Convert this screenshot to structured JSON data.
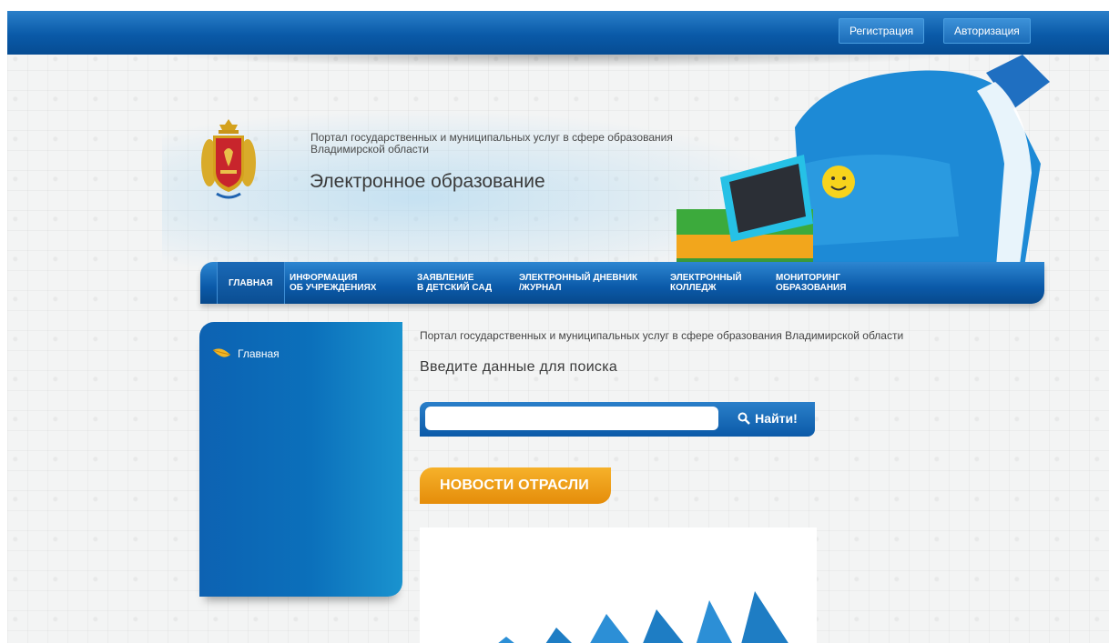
{
  "topbar": {
    "register_label": "Регистрация",
    "login_label": "Авторизация"
  },
  "header": {
    "subtitle": "Портал государственных и муниципальных услуг в сфере образования Владимирской области",
    "title": "Электронное образование"
  },
  "nav": {
    "items": [
      {
        "line1": "ГЛАВНАЯ",
        "line2": ""
      },
      {
        "line1": "ИНФОРМАЦИЯ",
        "line2": "ОБ УЧРЕЖДЕНИЯХ"
      },
      {
        "line1": "ЗАЯВЛЕНИЕ",
        "line2": "В ДЕТСКИЙ САД"
      },
      {
        "line1": "ЭЛЕКТРОННЫЙ ДНЕВНИК",
        "line2": "/ЖУРНАЛ"
      },
      {
        "line1": "ЭЛЕКТРОННЫЙ",
        "line2": "КОЛЛЕДЖ"
      },
      {
        "line1": "МОНИТОРИНГ",
        "line2": "ОБРАЗОВАНИЯ"
      }
    ]
  },
  "sidebar": {
    "items": [
      {
        "label": "Главная",
        "icon": "leaf-icon"
      }
    ]
  },
  "main": {
    "breadcrumb": "Портал государственных и муниципальных услуг в сфере образования Владимирской области",
    "search_label": "Введите данные для поиска",
    "search_value": "",
    "search_button": "Найти!",
    "news_tab": "НОВОСТИ ОТРАСЛИ"
  },
  "colors": {
    "primary_blue": "#0b5aa8",
    "orange": "#e58d0a"
  }
}
